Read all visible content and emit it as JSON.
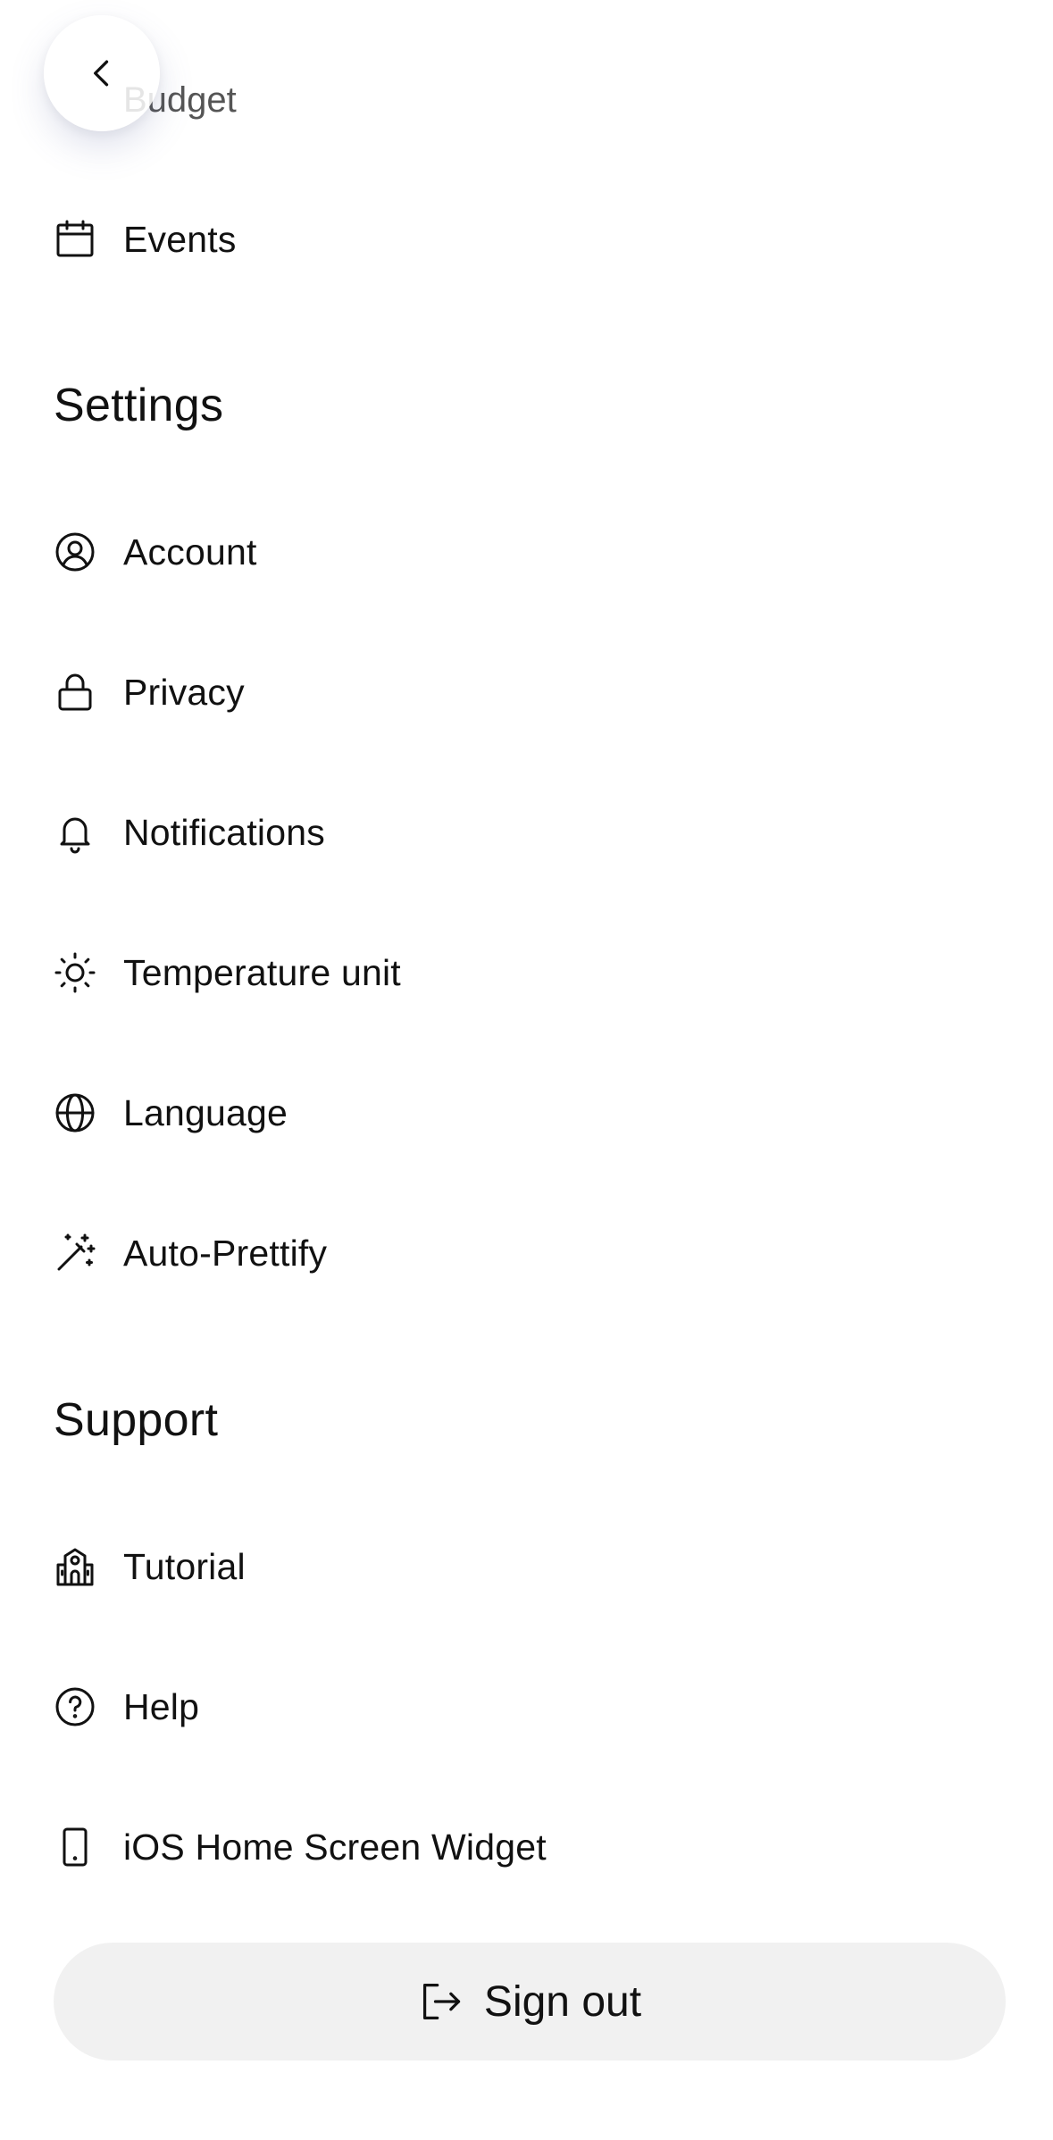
{
  "top": {
    "back_icon": "chevron-left-icon",
    "partial_item_label": "Budget"
  },
  "menu": {
    "events": {
      "label": "Events",
      "icon": "calendar-icon"
    }
  },
  "settings": {
    "title": "Settings",
    "items": [
      {
        "label": "Account",
        "icon": "user-circle-icon"
      },
      {
        "label": "Privacy",
        "icon": "lock-icon"
      },
      {
        "label": "Notifications",
        "icon": "bell-icon"
      },
      {
        "label": "Temperature unit",
        "icon": "sun-icon"
      },
      {
        "label": "Language",
        "icon": "globe-icon"
      },
      {
        "label": "Auto-Prettify",
        "icon": "magic-wand-icon"
      }
    ]
  },
  "support": {
    "title": "Support",
    "items": [
      {
        "label": "Tutorial",
        "icon": "school-icon"
      },
      {
        "label": "Help",
        "icon": "question-circle-icon"
      },
      {
        "label": "iOS Home Screen Widget",
        "icon": "phone-icon"
      }
    ]
  },
  "signout": {
    "label": "Sign out",
    "icon": "logout-icon",
    "bg_color": "#f1f1f1"
  }
}
